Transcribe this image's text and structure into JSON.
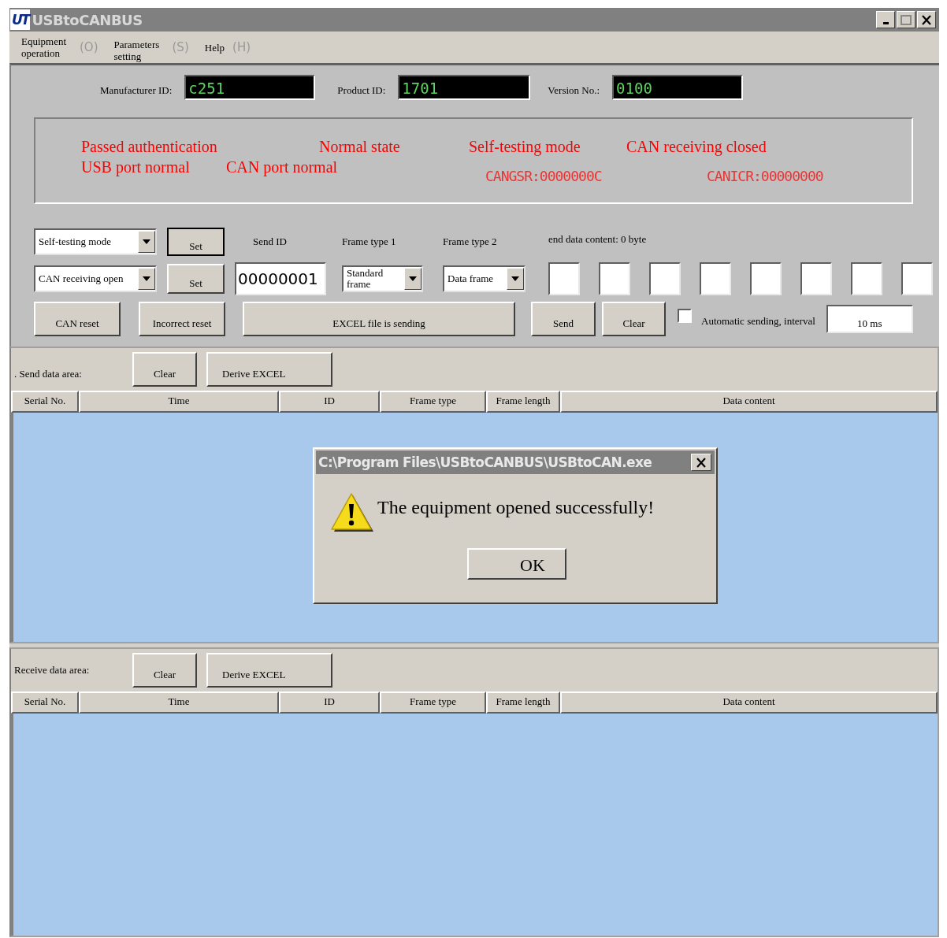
{
  "window": {
    "title": "USBtoCANBUS",
    "logo": "UT"
  },
  "menu": [
    {
      "label": "Equipment operation",
      "accel": "(O)"
    },
    {
      "label": "Parameters setting",
      "accel": "(S)"
    },
    {
      "label": "Help",
      "accel": "(H)"
    }
  ],
  "device": [
    {
      "label": "Manufacturer ID:",
      "value": "c251"
    },
    {
      "label": "Product ID:",
      "value": "1701"
    },
    {
      "label": "Version No.:",
      "value": "0100"
    }
  ],
  "status": {
    "row_1": [
      "Passed authentication",
      "Normal state",
      "Self-testing mode",
      "CAN receiving closed"
    ],
    "row_2": [
      "USB port normal",
      "CAN port normal"
    ],
    "registers": [
      "CANGSR:0000000C",
      "CANICR:00000000"
    ]
  },
  "controls": {
    "mode_select": "Self-testing mode",
    "mode_set": "Set",
    "receive_select": "CAN receiving open",
    "receive_set": "Set",
    "send_id_label": "Send ID",
    "send_id": "00000001",
    "frame_type_1_label": "Frame type 1",
    "frame_type_1": "Standard frame",
    "frame_type_2_label": "Frame type 2",
    "frame_type_2": "Data frame",
    "data_label": "end data content: 0 byte",
    "can_reset": "CAN reset",
    "incorrect_reset": "Incorrect reset",
    "excel_send": "EXCEL file is sending",
    "send": "Send",
    "clear": "Clear",
    "auto_send": {
      "label": "Automatic sending, interval",
      "checked": false
    },
    "interval": "10 ms"
  },
  "send_area": {
    "label": ". Send data area:",
    "clear": "Clear",
    "derive": "Derive EXCEL",
    "columns": [
      "Serial No.",
      "Time",
      "ID",
      "Frame type",
      "Frame length",
      "Data content"
    ]
  },
  "receive_area": {
    "label": "Receive data area:",
    "clear": "Clear",
    "derive": "Derive EXCEL",
    "columns": [
      "Serial No.",
      "Time",
      "ID",
      "Frame type",
      "Frame length",
      "Data content"
    ]
  },
  "dialog": {
    "title": "C:\\Program Files\\USBtoCANBUS\\USBtoCAN.exe",
    "message": "The equipment opened successfully!",
    "button": "OK"
  }
}
